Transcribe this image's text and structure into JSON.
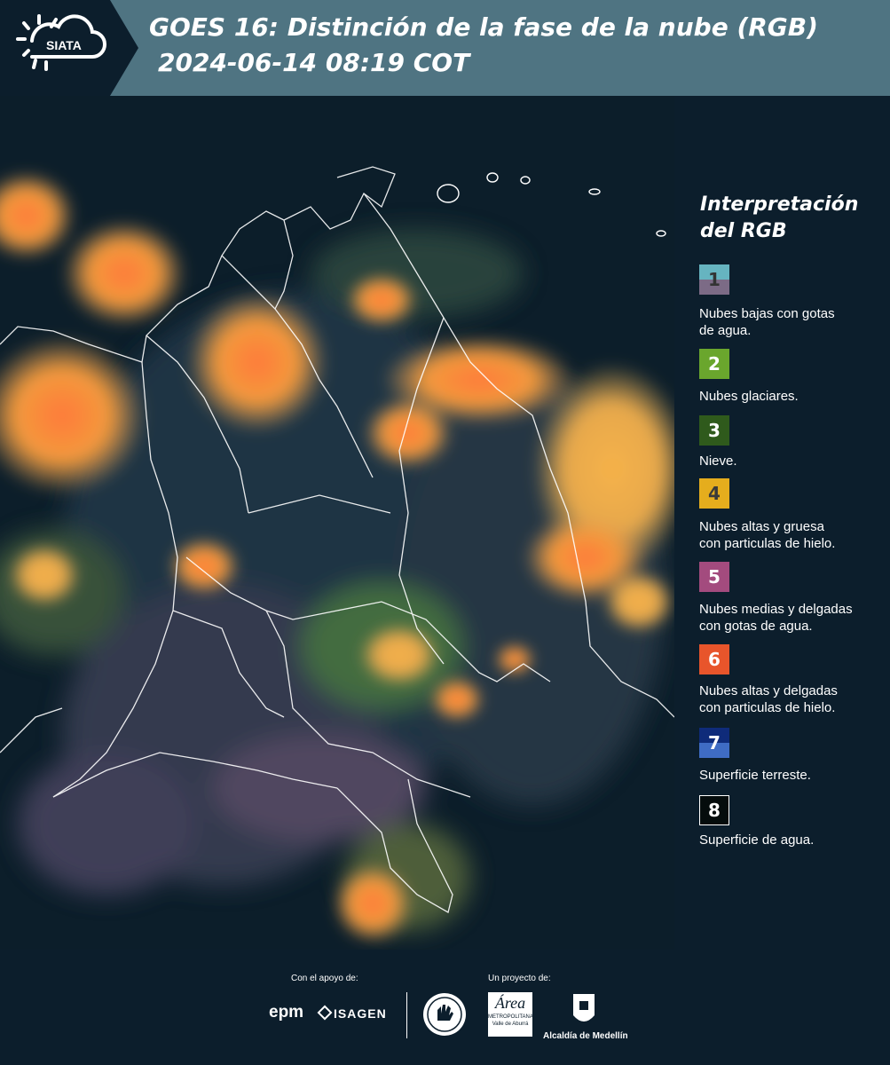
{
  "header": {
    "logo_text": "SIATA",
    "title_line1": "GOES 16: Distinción de la fase de la nube (RGB)",
    "title_line2": "2024-06-14 08:19 COT"
  },
  "legend": {
    "title_line1": "Interpretación",
    "title_line2": "del RGB",
    "items": [
      {
        "number": "1",
        "color_top": "#66b4c0",
        "color_bottom": "#7c6b86",
        "label_line1": "Nubes bajas con gotas",
        "label_line2": "de agua."
      },
      {
        "number": "2",
        "color": "#6aa62d",
        "label_line1": "Nubes glaciares.",
        "label_line2": ""
      },
      {
        "number": "3",
        "color": "#2f5a1c",
        "label_line1": "Nieve.",
        "label_line2": ""
      },
      {
        "number": "4",
        "color": "#e5ad1d",
        "label_line1": "Nubes altas y gruesa",
        "label_line2": "con particulas de hielo."
      },
      {
        "number": "5",
        "color": "#a34b7e",
        "label_line1": "Nubes medias y delgadas",
        "label_line2": "con gotas de agua."
      },
      {
        "number": "6",
        "color": "#e8552b",
        "label_line1": "Nubes altas y delgadas",
        "label_line2": "con particulas de hielo."
      },
      {
        "number": "7",
        "color_top": "#0f2b7a",
        "color_bottom": "#3f6cc4",
        "label_line1": "Superficie terreste.",
        "label_line2": ""
      },
      {
        "number": "8",
        "color": "#050c0c",
        "label_line1": "Superficie de agua.",
        "label_line2": ""
      }
    ]
  },
  "footer": {
    "support_label": "Con el apoyo de:",
    "project_label": "Un proyecto de:",
    "sponsor1": "epm",
    "sponsor2": "ISAGEN",
    "partner1_line1": "Área",
    "partner1_line2": "METROPOLITANA",
    "partner1_line3": "Valle de Aburrá",
    "partner2": "Alcaldía de Medellín"
  }
}
